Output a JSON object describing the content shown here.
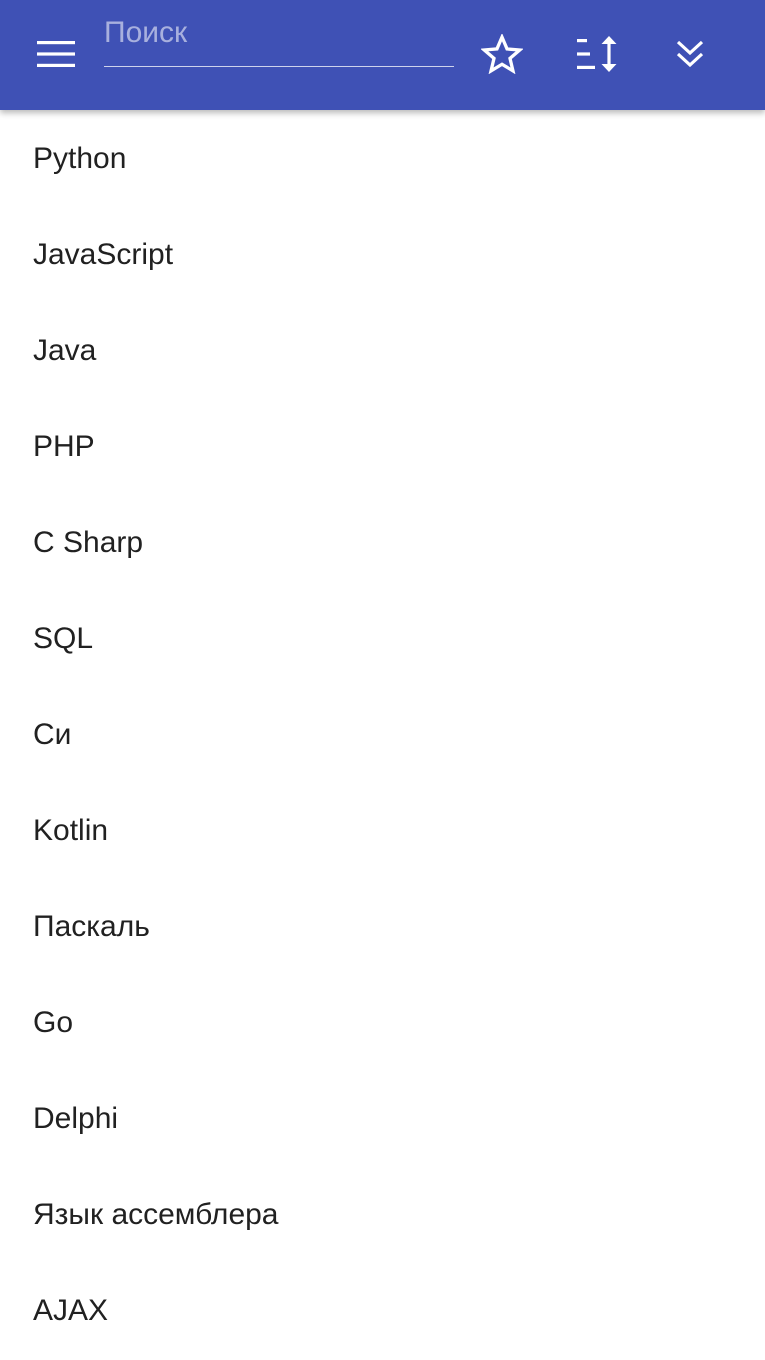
{
  "toolbar": {
    "menu_icon": "menu-icon",
    "search_placeholder": "Поиск",
    "search_value": "",
    "star_icon": "star-outline-icon",
    "sort_icon": "sort-icon",
    "expand_icon": "double-chevron-down-icon",
    "background_color": "#3f51b5"
  },
  "list": {
    "items": [
      "Python",
      "JavaScript",
      "Java",
      "PHP",
      "C Sharp",
      "SQL",
      "Си",
      "Kotlin",
      "Паскаль",
      "Go",
      "Delphi",
      "Язык ассемблера",
      "AJAX"
    ]
  }
}
